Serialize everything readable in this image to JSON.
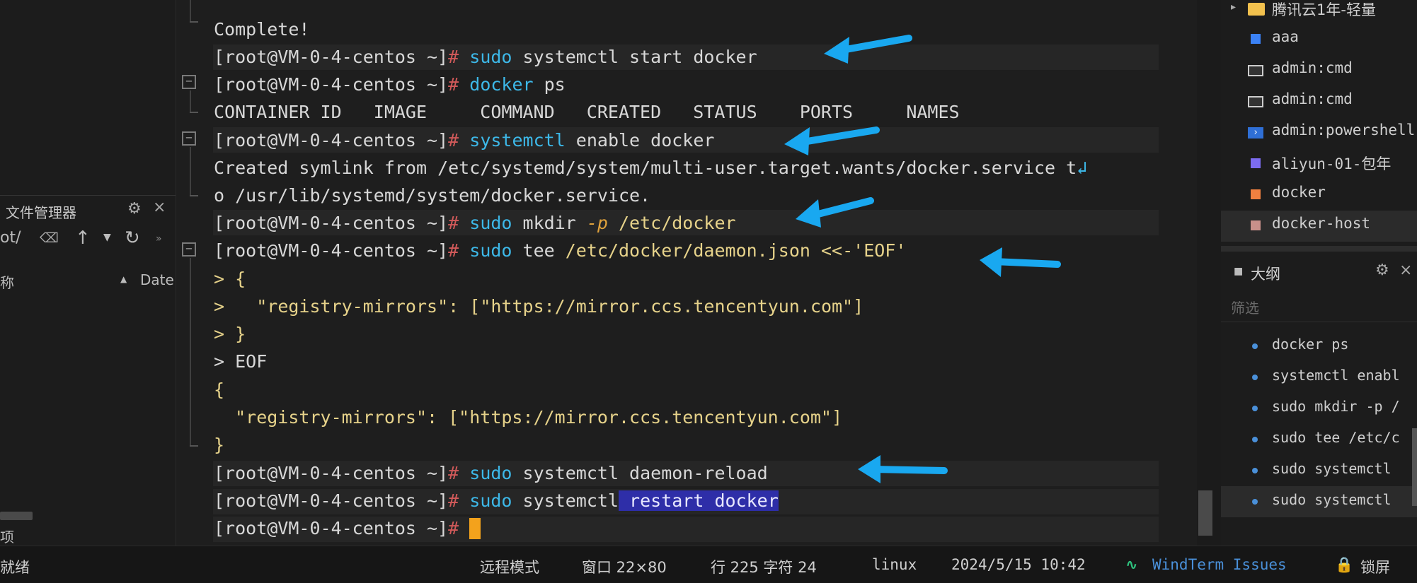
{
  "file_manager": {
    "title": "文件管理器",
    "path": "ot/",
    "col_name": "称",
    "col_date": "Date",
    "footer": "项"
  },
  "terminal": {
    "prompt_user": "[root@VM-0-4-centos ~]",
    "prompt_hash": "#",
    "lines": {
      "complete": "Complete!",
      "cmd1_kw": "sudo",
      "cmd1_rest": " systemctl start docker",
      "cmd2_kw": "docker",
      "cmd2_rest": " ps",
      "ps_header": "CONTAINER ID   IMAGE     COMMAND   CREATED   STATUS    PORTS     NAMES",
      "cmd3_kw": "systemctl",
      "cmd3_rest": " enable docker",
      "symlink1": "Created symlink from /etc/systemd/system/multi-user.target.wants/docker.service t",
      "symlink_wrap": "↲",
      "symlink2": "o /usr/lib/systemd/system/docker.service.",
      "cmd4_kw": "sudo",
      "cmd4_mid": " mkdir ",
      "cmd4_flag": "-p",
      "cmd4_rest": " /etc/docker",
      "cmd5_kw": "sudo",
      "cmd5_mid": " tee ",
      "cmd5_path": "/etc/docker/daemon.json",
      "cmd5_heredoc": " <<-'EOF'",
      "h1": "> {",
      "h2_prefix": ">   ",
      "h2_key": "\"registry-mirrors\"",
      "h2_mid": ": [",
      "h2_val": "\"https://mirror.ccs.tencentyun.com\"",
      "h2_end": "]",
      "h3": "> }",
      "h4": "> EOF",
      "j1": "{",
      "j2": "  \"registry-mirrors\": [\"https://mirror.ccs.tencentyun.com\"]",
      "j3": "}",
      "cmd6_kw": "sudo",
      "cmd6_rest": " systemctl daemon-reload",
      "cmd7_kw": "sudo",
      "cmd7_mid": " systemctl",
      "cmd7_sel": " restart docker"
    }
  },
  "sessions": {
    "group": "腾讯云1年-轻量",
    "items": [
      {
        "label": "aaa",
        "color": "#3b82f6",
        "icon": "square-icon"
      },
      {
        "label": "admin:cmd",
        "color": "#cccccc",
        "icon": "cmd-icon"
      },
      {
        "label": "admin:cmd",
        "color": "#cccccc",
        "icon": "cmd-icon"
      },
      {
        "label": "admin:powershell",
        "color": "#3b82f6",
        "icon": "powershell-icon"
      },
      {
        "label": "aliyun-01-包年",
        "color": "#7c6cf0",
        "icon": "square-icon"
      },
      {
        "label": "docker",
        "color": "#f08040",
        "icon": "square-icon"
      },
      {
        "label": "docker-host",
        "color": "#c8908a",
        "icon": "square-icon"
      }
    ]
  },
  "outline": {
    "title": "大纲",
    "filter_placeholder": "筛选",
    "items": [
      "docker ps",
      "systemctl enabl",
      "sudo mkdir -p /",
      "sudo tee /etc/c",
      "sudo systemctl",
      "sudo systemctl"
    ]
  },
  "status_bar": {
    "ready": "就绪",
    "mode": "远程模式",
    "window": "窗口 22×80",
    "position": "行 225 字符 24",
    "os": "linux",
    "datetime": "2024/5/15 10:42",
    "windterm_icon": "windterm-icon",
    "issues": "WindTerm Issues",
    "lock": "锁屏"
  },
  "colors": {
    "keyword": "#3db8e8",
    "prompt_hash": "#d25a5a",
    "flag": "#e0a23c",
    "selection": "#2e2ea8",
    "cursor": "#f3a21c",
    "annotation_arrow": "#19a8f0"
  }
}
